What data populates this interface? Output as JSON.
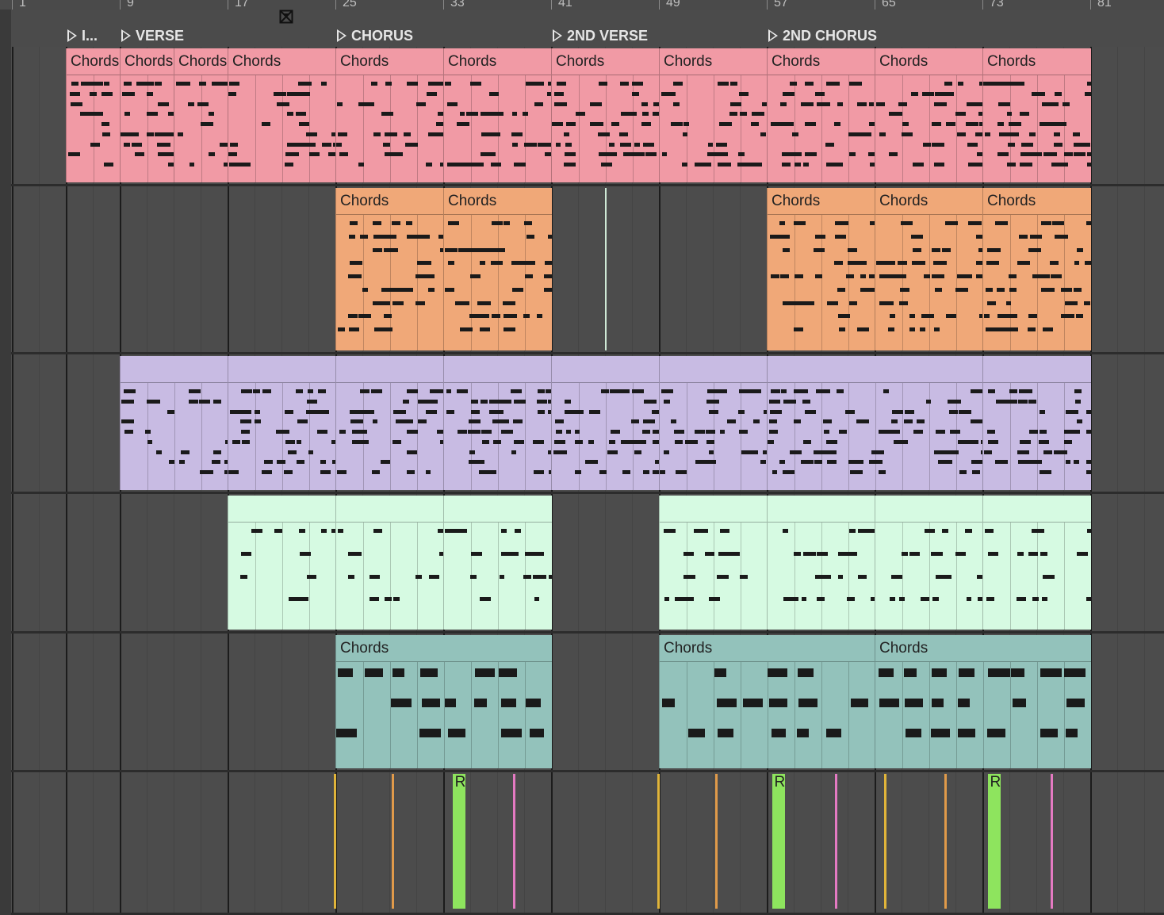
{
  "ruler": {
    "bars": [
      "1",
      "9",
      "17",
      "25",
      "33",
      "41",
      "49",
      "57",
      "65",
      "73",
      "81"
    ]
  },
  "locators": [
    "I...",
    "VERSE",
    "CHORUS",
    "2ND VERSE",
    "2ND CHORUS"
  ],
  "loop_icon": "loop-switch-icon",
  "tracks": [
    {
      "color": "#f19aa5",
      "clips": [
        {
          "name": "Chords"
        },
        {
          "name": "Chords"
        },
        {
          "name": "Chords"
        },
        {
          "name": "Chords"
        },
        {
          "name": "Chords"
        },
        {
          "name": "Chords"
        },
        {
          "name": "Chords"
        },
        {
          "name": "Chords"
        },
        {
          "name": "Chords"
        },
        {
          "name": "Chords"
        },
        {
          "name": "Chords"
        }
      ]
    },
    {
      "color": "#f0a878",
      "clips": [
        {
          "name": "Chords"
        },
        {
          "name": "Chords"
        },
        {
          "name": "Chords"
        },
        {
          "name": "Chords"
        },
        {
          "name": "Chords"
        }
      ]
    },
    {
      "color": "#c8bbe3",
      "clips": [
        {
          "name": ""
        },
        {
          "name": ""
        },
        {
          "name": ""
        },
        {
          "name": ""
        },
        {
          "name": ""
        },
        {
          "name": ""
        },
        {
          "name": ""
        },
        {
          "name": ""
        }
      ]
    },
    {
      "color": "#d6fae2",
      "clips": [
        {
          "name": ""
        },
        {
          "name": ""
        },
        {
          "name": ""
        },
        {
          "name": ""
        },
        {
          "name": ""
        },
        {
          "name": ""
        },
        {
          "name": ""
        }
      ]
    },
    {
      "color": "#93c2bb",
      "clips": [
        {
          "name": "Chords"
        },
        {
          "name": "Chords"
        },
        {
          "name": "Chords"
        }
      ]
    }
  ],
  "audio_track": {
    "clips": [
      {
        "label": "",
        "color": "#e0b43a"
      },
      {
        "label": "",
        "color": "#e09a4a"
      },
      {
        "label": "R",
        "color": "#8ee45e"
      },
      {
        "label": "",
        "color": "#e47ac2"
      },
      {
        "label": "",
        "color": "#e0b43a"
      },
      {
        "label": "",
        "color": "#e09a4a"
      },
      {
        "label": "R",
        "color": "#8ee45e"
      },
      {
        "label": "",
        "color": "#e47ac2"
      },
      {
        "label": "",
        "color": "#e0b43a"
      },
      {
        "label": "",
        "color": "#e09a4a"
      },
      {
        "label": "R",
        "color": "#8ee45e"
      },
      {
        "label": "",
        "color": "#e47ac2"
      }
    ]
  }
}
